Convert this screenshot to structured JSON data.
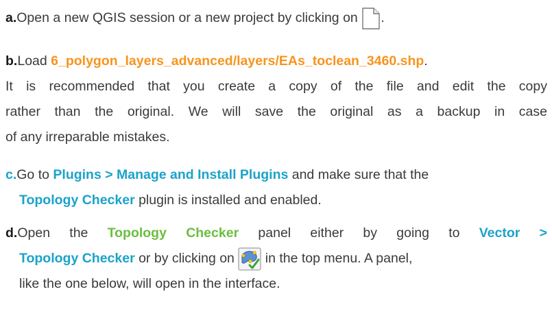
{
  "steps": {
    "a": {
      "letter": "a.",
      "text": "Open a new QGIS session or a new project by clicking on",
      "end": ".",
      "icon": "new-file-icon"
    },
    "b": {
      "letter": "b.",
      "prefix": "Load ",
      "path": "6_polygon_layers_advanced/layers/EAs_toclean_3460.shp",
      "end": ".",
      "line2": "It is recommended that you create a copy of the file and edit the copy",
      "line3": "rather than the original. We will save the original as a backup in case",
      "line4": "of any irreparable mistakes."
    },
    "c": {
      "letter": "c.",
      "prefix": "Go to ",
      "menu": "Plugins > Manage and Install Plugins",
      "suffix": " and make sure that the",
      "plugin": "Topology Checker",
      "line2_rest": " plugin is installed and enabled."
    },
    "d": {
      "letter": "d.",
      "prefix": "Open the ",
      "panel": "Topology Checker",
      "mid": " panel either by going to ",
      "menu1": "Vector >",
      "menu2": "Topology Checker",
      "mid2": " or by clicking on ",
      "icon": "topology-checker-icon",
      "after_icon": " in the top menu. A panel,",
      "line3": "like the one below, will open in the interface."
    }
  },
  "colors": {
    "orange": "#f7941d",
    "blue": "#1aa3c9",
    "green": "#6abf3f",
    "text": "#3a3a3a"
  }
}
